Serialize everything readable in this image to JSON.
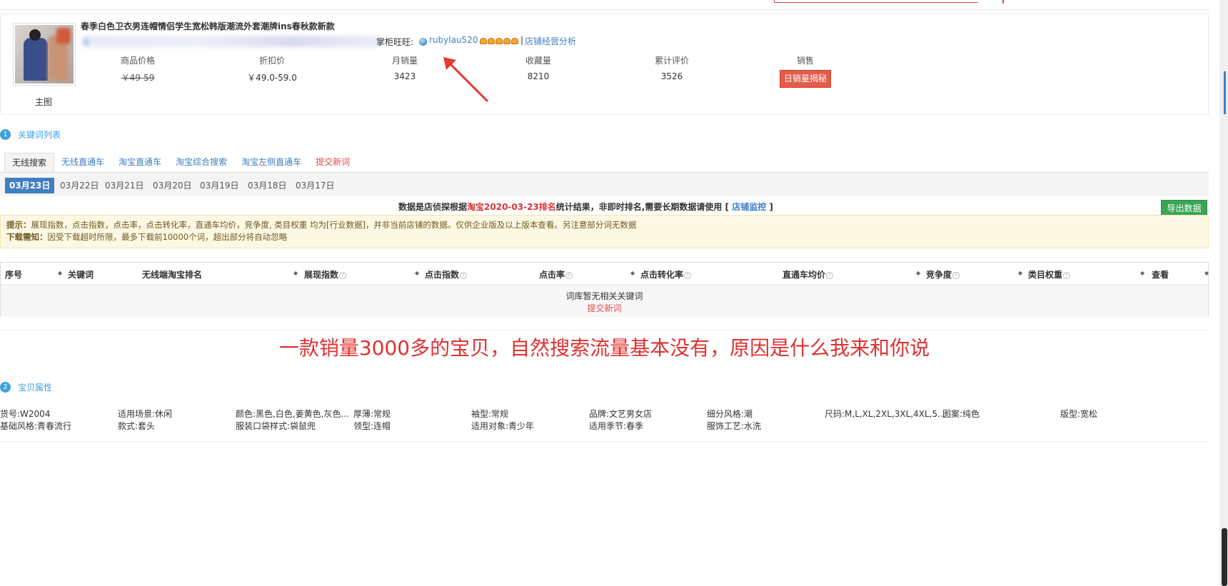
{
  "product": {
    "title": "春季白色卫衣男连帽情侣学生宽松韩版潮流外套潮牌ins春秋款新款",
    "seller_label": "掌柜旺旺:",
    "seller_name": "rubylau520",
    "separator": "|",
    "shop_analysis": "店铺经营分析",
    "main_image_caption": "主图",
    "stats": {
      "price_label": "商品价格",
      "price_value": "￥49-59",
      "discount_label": "折扣价",
      "discount_value": "￥49.0-59.0",
      "monthly_sales_label": "月销量",
      "monthly_sales_value": "3423",
      "favorites_label": "收藏量",
      "favorites_value": "8210",
      "reviews_label": "累计评价",
      "reviews_value": "3526",
      "sales_label": "销售",
      "daily_sales_button": "日销量揭秘"
    }
  },
  "keyword_section": {
    "number": "1",
    "title": "关键词列表",
    "tabs": [
      {
        "label": "无线搜索",
        "active": true
      },
      {
        "label": "无线直通车"
      },
      {
        "label": "淘宝直通车"
      },
      {
        "label": "淘宝综合搜索"
      },
      {
        "label": "淘宝左侧直通车"
      },
      {
        "label": "提交新词",
        "red": true
      }
    ],
    "dates": [
      "03月23日",
      "03月22日",
      "03月21日",
      "03月20日",
      "03月19日",
      "03月18日",
      "03月17日"
    ],
    "active_date_index": 0,
    "note": {
      "prefix": "数据是店侦探根据",
      "highlight": "淘宝2020-03-23排名",
      "middle": "统计结果，非即时排名,需要长期数据请使用 [",
      "link": "店铺监控",
      "suffix": "]"
    },
    "export_button": "导出数据",
    "tip_label": "提示：",
    "tip_text": "展现指数，点击指数，点击率，点击转化率，直通车均价，竞争度, 类目权重 均为[行业数据]，并非当前店铺的数据。仅供企业版及以上版本查看。另注意部分词无数据",
    "download_label": "下载需知：",
    "download_text": "因受下载超时所限，最多下载前10000个词，超出部分将自动忽略",
    "columns": [
      "序号",
      "关键词",
      "无线端淘宝排名",
      "展现指数",
      "点击指数",
      "点击率",
      "点击转化率",
      "直通车均价",
      "竞争度",
      "类目权重",
      "查看"
    ],
    "empty_text": "词库暂无相关关键词",
    "empty_link": "提交新词"
  },
  "caption": "一款销量3000多的宝贝，自然搜索流量基本没有，原因是什么我来和你说",
  "attributes_section": {
    "number": "2",
    "title": "宝贝属性",
    "row1": [
      "货号:W2004",
      "适用场景:休闲",
      "颜色:黑色,白色,姜黄色,灰色...",
      "厚薄:常规",
      "袖型:常规",
      "品牌:文艺男女店",
      "细分风格:潮",
      "尺码:M,L,XL,2XL,3XL,4XL,5...",
      "图案:纯色",
      "版型:宽松"
    ],
    "row2": [
      "基础风格:青春流行",
      "款式:套头",
      "服装口袋样式:袋鼠兜",
      "领型:连帽",
      "适用对象:青少年",
      "适用季节:春季",
      "服饰工艺:水洗"
    ]
  },
  "colors": {
    "accent_blue": "#3f7fc4",
    "section_blue": "#3fa2e0",
    "alert_red": "#e03131",
    "export_green": "#3aa556"
  }
}
